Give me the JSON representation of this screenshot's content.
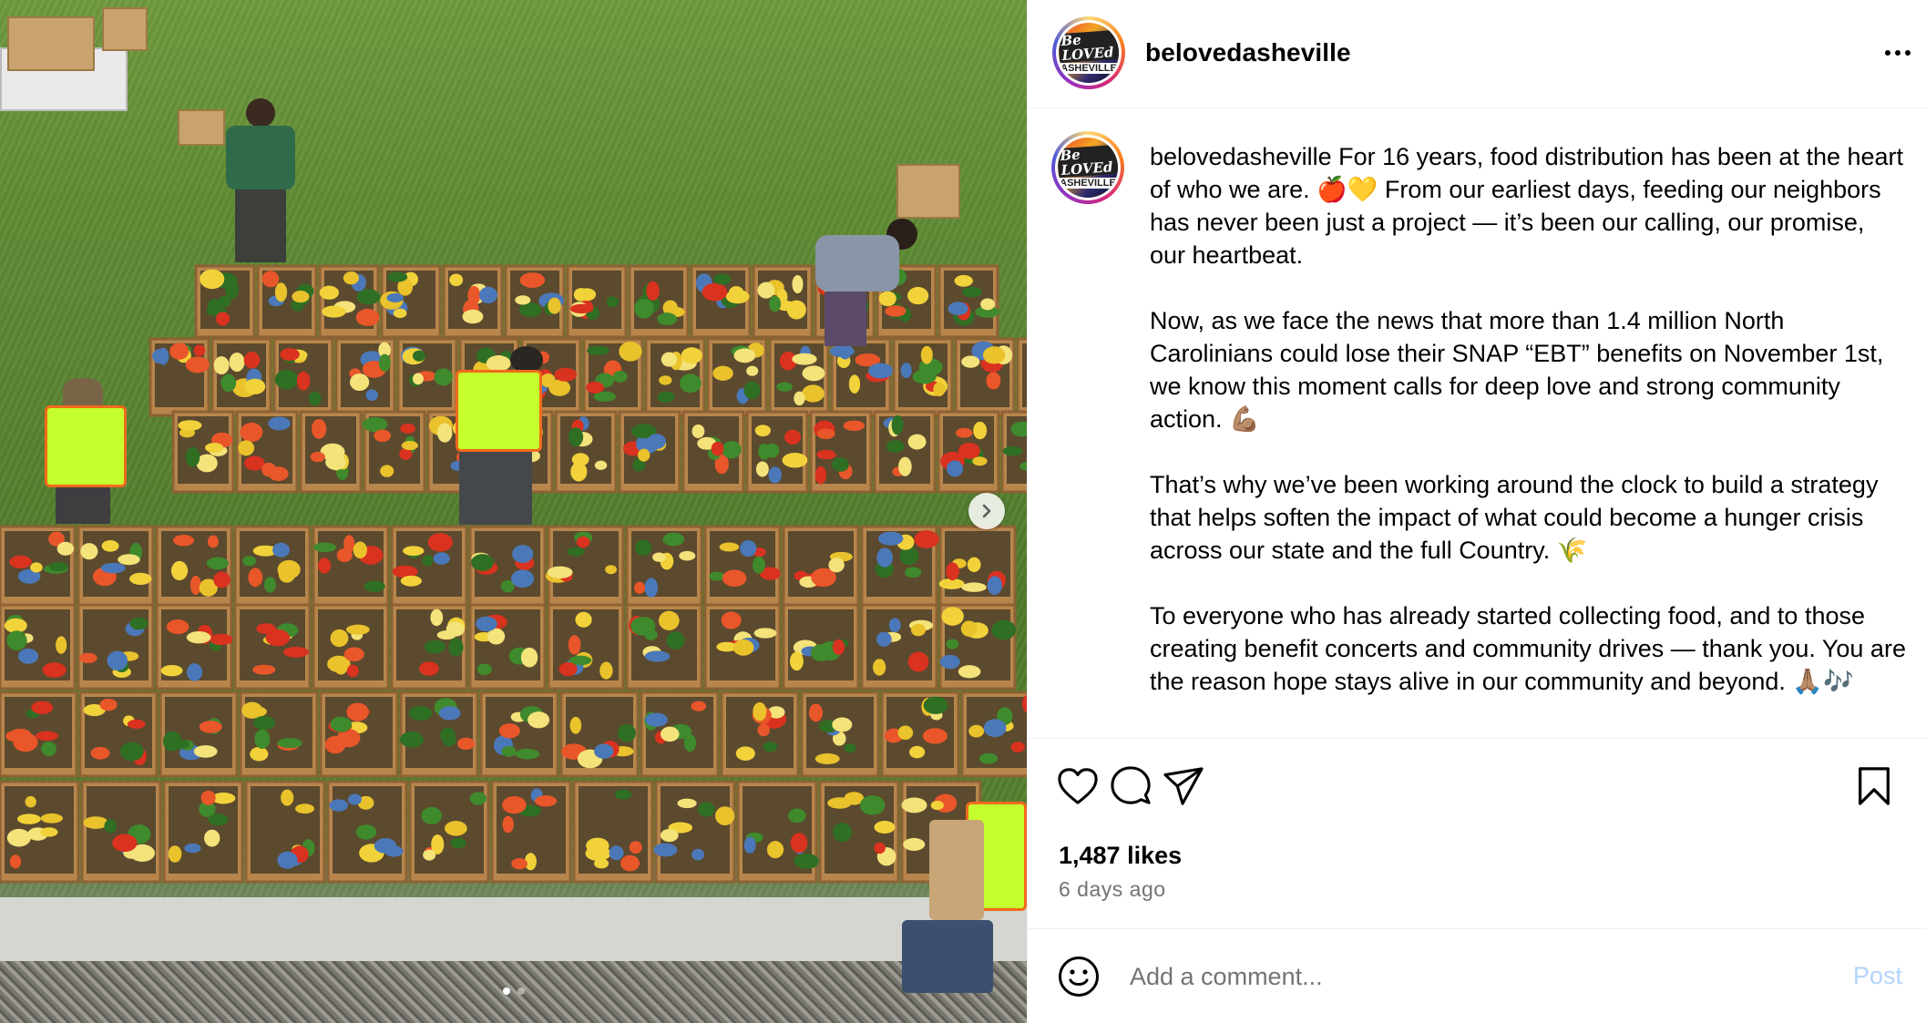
{
  "photo": {
    "alt_scene": "food boxes photo",
    "carousel": {
      "count": 2,
      "active_index": 0
    }
  },
  "post": {
    "username": "belovedasheville",
    "avatar_logo_top": "Be LOVEd",
    "avatar_logo_bottom": "ASHEVILLE",
    "caption_user": "belovedasheville",
    "caption_paragraphs": [
      " For 16 years, food distribution has been at the heart of who we are. 🍎💛 From our earliest days, feeding our neighbors has never been just a project — it’s been our calling, our promise, our heartbeat.",
      "Now, as we face the news that more than 1.4 million North Carolinians could lose their SNAP “EBT” benefits on November 1st, we know this moment calls for deep love and strong community action. 💪🏽",
      "That’s why we’ve been working around the clock to build a strategy that helps soften the impact of what could become a hunger crisis across our state and the full Country. 🌾",
      "To everyone who has already started collecting food, and to those creating benefit concerts and community drives — thank you. You are the reason hope stays alive in our community and beyond. 🙏🏽🎶"
    ],
    "likes": "1,487 likes",
    "time_ago": "6 days ago"
  },
  "comment": {
    "placeholder": "Add a comment...",
    "post_label": "Post"
  },
  "icons": {
    "like": "heart-icon",
    "comment": "comment-icon",
    "share": "share-icon",
    "save": "bookmark-icon",
    "emoji": "emoji-icon",
    "more": "more-options-icon",
    "next": "chevron-right-icon"
  },
  "colors": {
    "post_button_disabled": "#b3d4fc",
    "secondary_text": "#737373",
    "vest": "#c6ff2e"
  }
}
